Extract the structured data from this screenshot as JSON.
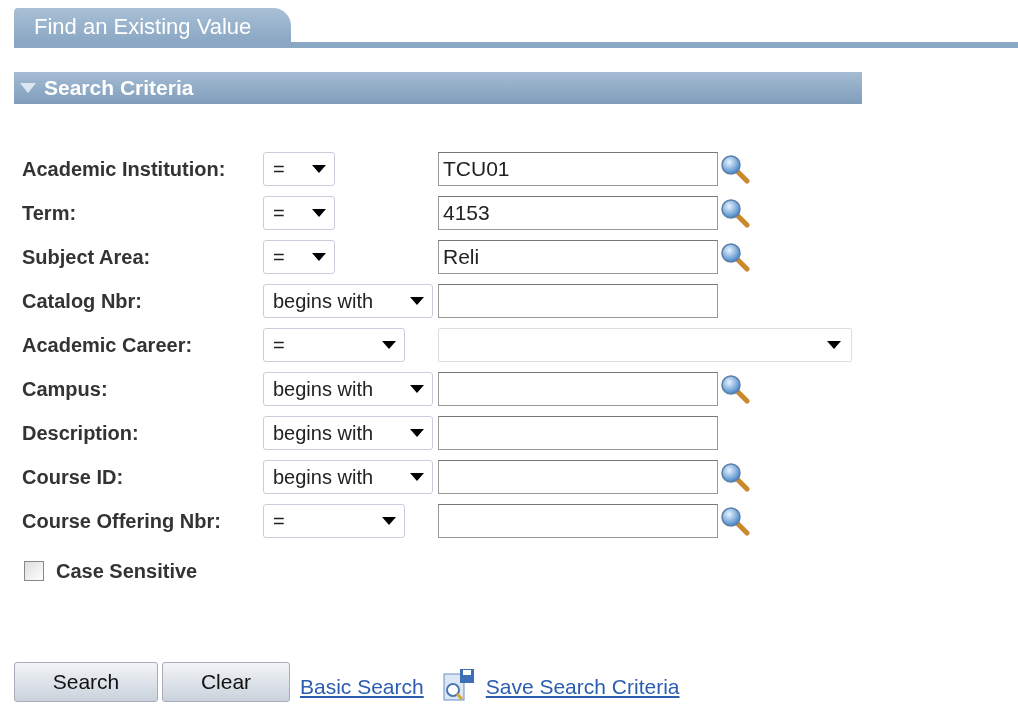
{
  "tabs": [
    {
      "label": "Find an Existing Value",
      "selected": true
    }
  ],
  "section": {
    "title": "Search Criteria",
    "expanded": true
  },
  "rows": [
    {
      "label": "Academic Institution:",
      "operator": {
        "value": "=",
        "kind": "compact"
      },
      "kind": "lookup",
      "value": "TCU01"
    },
    {
      "label": "Term:",
      "operator": {
        "value": "=",
        "kind": "compact"
      },
      "kind": "lookup",
      "value": "4153"
    },
    {
      "label": "Subject Area:",
      "operator": {
        "value": "=",
        "kind": "compact"
      },
      "kind": "lookup",
      "value": "Reli"
    },
    {
      "label": "Catalog Nbr:",
      "operator": {
        "value": "begins with",
        "kind": "long"
      },
      "kind": "plain"
    },
    {
      "label": "Academic Career:",
      "operator": {
        "value": "=",
        "kind": "wide"
      },
      "kind": "dropdown"
    },
    {
      "label": "Campus:",
      "operator": {
        "value": "begins with",
        "kind": "long"
      },
      "kind": "lookup"
    },
    {
      "label": "Description:",
      "operator": {
        "value": "begins with",
        "kind": "long"
      },
      "kind": "plain"
    },
    {
      "label": "Course ID:",
      "operator": {
        "value": "begins with",
        "kind": "long"
      },
      "kind": "lookup"
    },
    {
      "label": "Course Offering Nbr:",
      "operator": {
        "value": "=",
        "kind": "wide"
      },
      "kind": "lookup"
    }
  ],
  "case_sensitive": {
    "label": "Case Sensitive",
    "checked": false
  },
  "buttons": [
    "Search",
    "Clear"
  ],
  "links": [
    {
      "label": "Basic Search",
      "kind": "plain"
    },
    {
      "label": "Save Search Criteria",
      "kind": "save"
    }
  ]
}
